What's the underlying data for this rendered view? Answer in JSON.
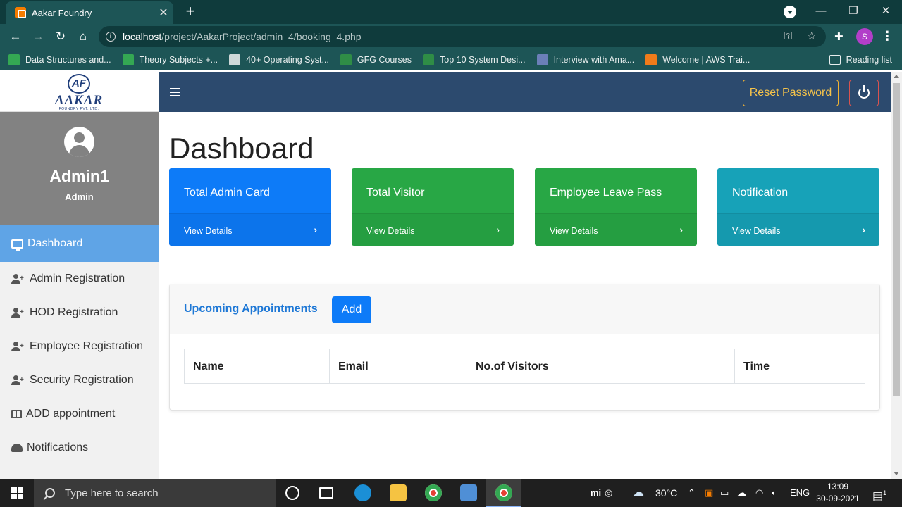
{
  "browser": {
    "tab_title": "Aakar Foundry",
    "tab_close": "✕",
    "new_tab": "+",
    "url_host": "localhost",
    "url_path": "/project/AakarProject/admin_4/booking_4.php",
    "profile_initial": "S",
    "bookmarks": [
      {
        "label": "Data Structures and...",
        "icon": "plus-icon",
        "color": "#34a853"
      },
      {
        "label": "Theory Subjects +...",
        "icon": "plus-icon",
        "color": "#34a853"
      },
      {
        "label": "40+ Operating Syst...",
        "icon": "mountain-icon",
        "color": "#cfd8d8"
      },
      {
        "label": "GFG Courses",
        "icon": "gfg-icon",
        "color": "#2f8d46"
      },
      {
        "label": "Top 10 System Desi...",
        "icon": "gfg-icon",
        "color": "#2f8d46"
      },
      {
        "label": "Interview with Ama...",
        "icon": "dk-icon",
        "color": "#6b7fb8"
      },
      {
        "label": "Welcome | AWS Trai...",
        "icon": "aws-cube-icon",
        "color": "#f07b1a"
      }
    ],
    "reading_list": "Reading list"
  },
  "logo": {
    "mark": "AF",
    "name": "AAKAR",
    "sub": "FOUNDRY PVT. LTD."
  },
  "profile": {
    "name": "Admin1",
    "role": "Admin"
  },
  "sidebar": {
    "items": [
      {
        "label": "Dashboard",
        "icon": "monitor-icon",
        "active": true
      },
      {
        "label": "Admin Registration",
        "icon": "user-plus-icon"
      },
      {
        "label": "HOD Registration",
        "icon": "user-plus-icon"
      },
      {
        "label": "Employee Registration",
        "icon": "user-plus-icon"
      },
      {
        "label": "Security Registration",
        "icon": "user-plus-icon"
      },
      {
        "label": "ADD appointment",
        "icon": "table-icon"
      },
      {
        "label": "Notifications",
        "icon": "gauge-icon"
      }
    ]
  },
  "topbar": {
    "reset_label": "Reset Password"
  },
  "main": {
    "title": "Dashboard",
    "cards": [
      {
        "title": "Total Admin Card",
        "link": "View Details",
        "color": "#0d7bf8"
      },
      {
        "title": "Total Visitor",
        "link": "View Details",
        "color": "#28a745"
      },
      {
        "title": "Employee Leave Pass",
        "link": "View Details",
        "color": "#28a745"
      },
      {
        "title": "Notification",
        "link": "View Details",
        "color": "#17a2b8"
      }
    ],
    "card_arrow": "›",
    "appointments": {
      "title": "Upcoming Appointments",
      "add_label": "Add",
      "columns": [
        "Name",
        "Email",
        "No.of Visitors",
        "Time"
      ]
    }
  },
  "taskbar": {
    "search_placeholder": "Type here to search",
    "weather": "30°C",
    "language": "ENG",
    "time": "13:09",
    "date": "30-09-2021",
    "notification_count": "1"
  }
}
